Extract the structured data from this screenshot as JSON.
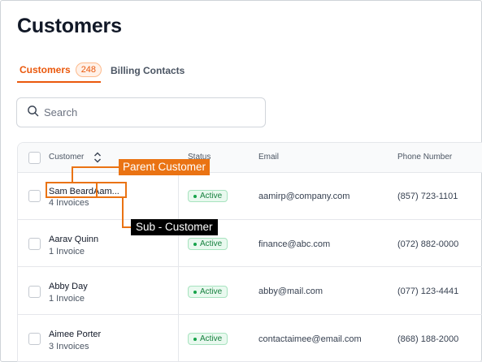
{
  "page": {
    "title": "Customers"
  },
  "tabs": [
    {
      "label": "Customers",
      "count": "248",
      "active": true
    },
    {
      "label": "Billing Contacts",
      "active": false
    }
  ],
  "search": {
    "placeholder": "Search",
    "value": ""
  },
  "table": {
    "headers": {
      "customer": "Customer",
      "status": "Status",
      "email": "Email",
      "phone": "Phone Number"
    },
    "rows": [
      {
        "name_parent": "Sam Beard",
        "name_sub": "Aam...",
        "invoices": "4 Invoices",
        "status": "Active",
        "email": "aamirp@company.com",
        "phone": "(857) 723-1101"
      },
      {
        "name": "Aarav Quinn",
        "invoices": "1 Invoice",
        "status": "Active",
        "email": "finance@abc.com",
        "phone": "(072) 882-0000"
      },
      {
        "name": "Abby Day",
        "invoices": "1 Invoice",
        "status": "Active",
        "email": "abby@mail.com",
        "phone": "(077) 123-4441"
      },
      {
        "name": "Aimee Porter",
        "invoices": "3 Invoices",
        "status": "Active",
        "email": "contactaimee@email.com",
        "phone": "(868) 188-2000"
      }
    ]
  },
  "annotations": {
    "parent": "Parent Customer",
    "sub": "Sub - Customer"
  },
  "colors": {
    "accent": "#ea580c",
    "annotation": "#ea7313",
    "active_green": "#15803d"
  },
  "icons": {
    "search": "search-icon",
    "sort": "sort-icon"
  }
}
